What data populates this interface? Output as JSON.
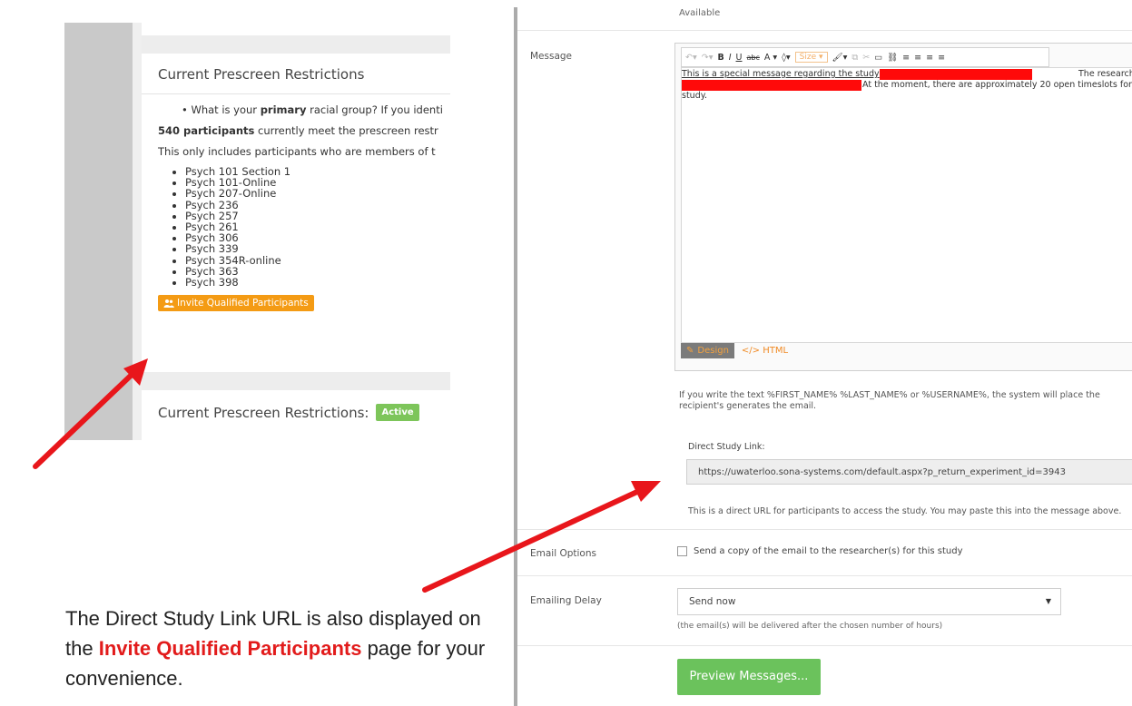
{
  "left": {
    "section_title": "Current Prescreen Restrictions",
    "question_prefix": "What is your ",
    "question_bold": "primary",
    "question_suffix": " racial group? If you identi",
    "count_bold": "540 participants",
    "count_rest": " currently meet the prescreen restr",
    "members_text": "This only includes participants who are members of t",
    "courses": [
      "Psych 101 Section 1",
      "Psych 101-Online",
      "Psych 207-Online",
      "Psych 236",
      "Psych 257",
      "Psych 261",
      "Psych 306",
      "Psych 339",
      "Psych 354R-online",
      "Psych 363",
      "Psych 398"
    ],
    "invite_button": "Invite Qualified Participants",
    "bottom_title": "Current Prescreen Restrictions:",
    "active_badge": "Active"
  },
  "caption": {
    "part1": "The Direct Study Link URL is also displayed on the ",
    "highlight": "Invite Qualified Participants",
    "part2": " page for your convenience."
  },
  "right": {
    "available": "Available",
    "message_label": "Message",
    "toolbar": {
      "bold": "B",
      "italic": "I",
      "underline": "U",
      "strike": "abc",
      "font_color": "A ▾",
      "size": "Size ▾"
    },
    "message_lines": [
      "This is a special message regarding the study",
      "The researchers are",
      "At the moment, there are approximately 20 open timeslots for",
      "study."
    ],
    "design_tab": "Design",
    "html_tab": "HTML",
    "hint_text": "If you write the text %FIRST_NAME% %LAST_NAME% or %USERNAME%, the system will place the recipient's generates the email.",
    "dsl_label": "Direct Study Link:",
    "dsl_url": "https://uwaterloo.sona-systems.com/default.aspx?p_return_experiment_id=3943",
    "dsl_help": "This is a direct URL for participants to access the study. You may paste this into the message above.",
    "email_options_label": "Email Options",
    "email_copy_text": "Send a copy of the email to the researcher(s) for this study",
    "delay_label": "Emailing Delay",
    "delay_value": "Send now",
    "delay_note": "(the email(s) will be delivered after the chosen number of hours)",
    "preview_button": "Preview Messages..."
  },
  "colors": {
    "invite_orange": "#f49b14",
    "active_green": "#7dc55a",
    "preview_green": "#6bc25c",
    "arrow_red": "#e8161b",
    "redaction_red": "#ff0a0a"
  }
}
